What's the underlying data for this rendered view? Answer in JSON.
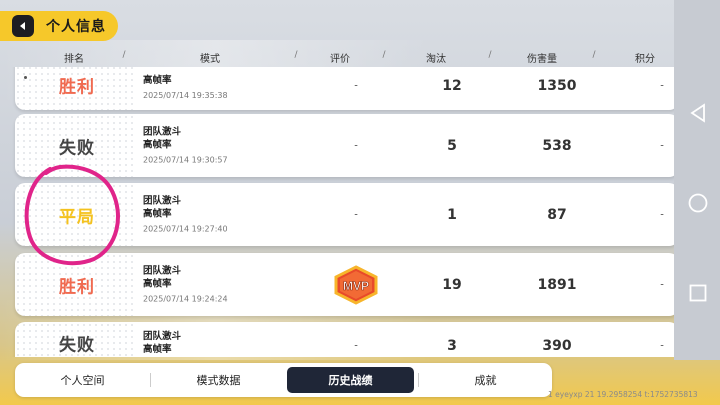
{
  "page_title": "个人信息",
  "columns": {
    "rank": "排名",
    "mode": "模式",
    "rating": "评价",
    "eliminations": "淘汰",
    "damage": "伤害量",
    "score": "积分",
    "separator": "/"
  },
  "matches": [
    {
      "result": "胜利",
      "result_type": "win",
      "mode": "",
      "quality": "高帧率",
      "time": "2025/07/14 19:35:38",
      "rating": "-",
      "eliminations": "12",
      "damage": "1350",
      "score": "-"
    },
    {
      "result": "失败",
      "result_type": "lose",
      "mode": "团队激斗",
      "quality": "高帧率",
      "time": "2025/07/14 19:30:57",
      "rating": "-",
      "eliminations": "5",
      "damage": "538",
      "score": "-"
    },
    {
      "result": "平局",
      "result_type": "draw",
      "mode": "团队激斗",
      "quality": "高帧率",
      "time": "2025/07/14 19:27:40",
      "rating": "-",
      "eliminations": "1",
      "damage": "87",
      "score": "-"
    },
    {
      "result": "胜利",
      "result_type": "win",
      "mode": "团队激斗",
      "quality": "高帧率",
      "time": "2025/07/14 19:24:24",
      "rating": "MVP",
      "eliminations": "19",
      "damage": "1891",
      "score": "-"
    },
    {
      "result": "失败",
      "result_type": "lose",
      "mode": "团队激斗",
      "quality": "高帧率",
      "time": "",
      "rating": "-",
      "eliminations": "3",
      "damage": "390",
      "score": "-"
    }
  ],
  "mvp_badge_text": "MVP",
  "bottom_tabs": [
    {
      "label": "个人空间",
      "active": false
    },
    {
      "label": "模式数据",
      "active": false
    },
    {
      "label": "历史战绩",
      "active": true
    },
    {
      "label": "成就",
      "active": false
    }
  ],
  "debug_text": "1 eyeyxp 21 19.2958254 t:1752735813",
  "colors": {
    "accent": "#f6c82a",
    "win": "#f06a50",
    "draw": "#f4c21e",
    "lose": "#444444",
    "active_tab": "#1f2637",
    "annotation": "#e0248a"
  },
  "icons": {
    "back": "back-arrow-icon",
    "system_back": "nav-back-icon",
    "system_home": "nav-home-icon",
    "system_recent": "nav-recent-icon"
  }
}
